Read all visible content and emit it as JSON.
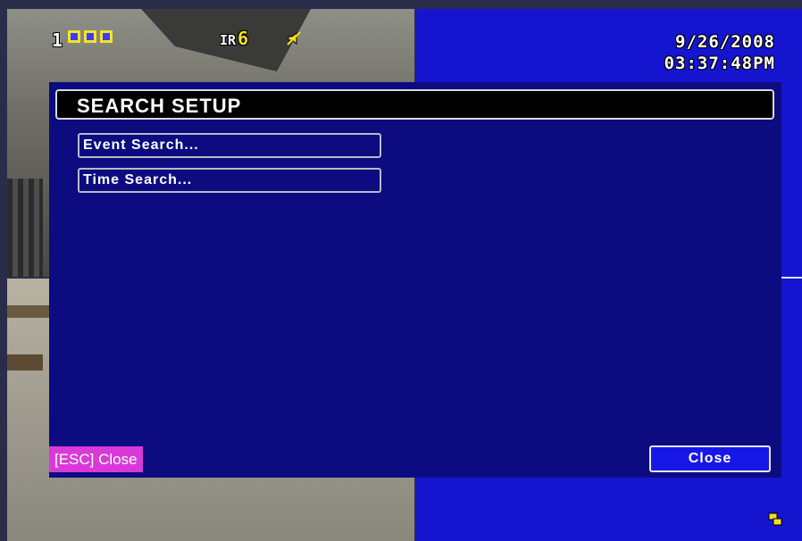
{
  "osd": {
    "camera_number": "1",
    "ir_label": "IR",
    "ir_value": "6",
    "date": "9/26/2008",
    "time": "03:37:48PM"
  },
  "dialog": {
    "title": "SEARCH SETUP",
    "menu_items": [
      {
        "label": "Event Search..."
      },
      {
        "label": "Time Search..."
      }
    ],
    "esc_hint": "[ESC] Close",
    "close_label": "Close"
  },
  "colors": {
    "dialog_bg": "#0c0c80",
    "accent_blue": "#1515d0",
    "esc_badge": "#d83ad8",
    "osd_yellow": "#f2df22"
  },
  "icons": {
    "channel_indicators": "channel-status-icon",
    "mute": "speaker-mute-icon",
    "corner": "sequence-icon"
  }
}
